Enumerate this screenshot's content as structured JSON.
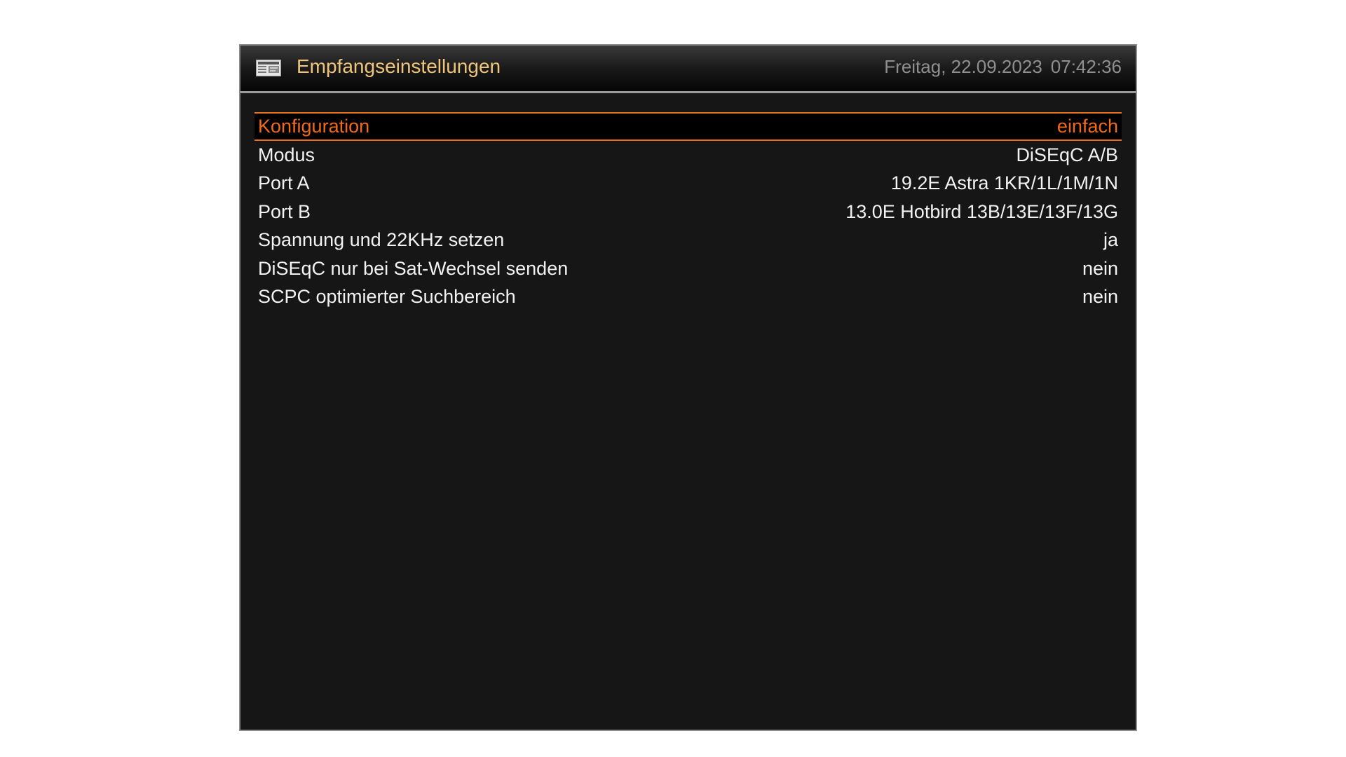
{
  "header": {
    "title": "Empfangseinstellungen",
    "icon": "settings-screen-icon",
    "date": "Freitag, 22.09.2023",
    "time": "07:42:36"
  },
  "colors": {
    "accent": "#f06a16",
    "title": "#f0c57a",
    "text": "#f2f2f2",
    "muted": "#8f8f8f",
    "background": "#161616"
  },
  "settings": [
    {
      "label": "Konfiguration",
      "value": "einfach",
      "selected": true
    },
    {
      "label": "Modus",
      "value": "DiSEqC A/B",
      "selected": false
    },
    {
      "label": "Port A",
      "value": "19.2E Astra 1KR/1L/1M/1N",
      "selected": false
    },
    {
      "label": "Port B",
      "value": "13.0E Hotbird 13B/13E/13F/13G",
      "selected": false
    },
    {
      "label": "Spannung und 22KHz setzen",
      "value": "ja",
      "selected": false
    },
    {
      "label": "DiSEqC nur bei Sat-Wechsel senden",
      "value": "nein",
      "selected": false
    },
    {
      "label": "SCPC optimierter Suchbereich",
      "value": "nein",
      "selected": false
    }
  ]
}
